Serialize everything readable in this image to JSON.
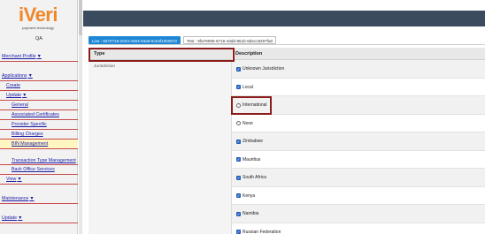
{
  "brand": {
    "name": "iVeri",
    "tagline": "payment technology",
    "environment": "QA"
  },
  "sidebar": {
    "items": [
      {
        "label": "Merchant Profile",
        "level": 0,
        "caret": true
      },
      {
        "label": "Applications",
        "level": 0,
        "caret": true
      },
      {
        "label": "Create",
        "level": 1,
        "caret": false
      },
      {
        "label": "Update",
        "level": 1,
        "caret": true
      },
      {
        "label": "General",
        "level": 2,
        "caret": false
      },
      {
        "label": "Associated Certificates",
        "level": 2,
        "caret": false
      },
      {
        "label": "Provider Specific",
        "level": 2,
        "caret": false
      },
      {
        "label": "Billing Charges",
        "level": 2,
        "caret": false
      },
      {
        "label": "BIN Management",
        "level": 2,
        "caret": false,
        "active": true
      },
      {
        "label": "Transaction Type Management",
        "level": 2,
        "caret": false
      },
      {
        "label": "Back Office Services",
        "level": 2,
        "caret": false
      },
      {
        "label": "View",
        "level": 1,
        "caret": true
      },
      {
        "label": "Maintenance",
        "level": 0,
        "caret": true
      },
      {
        "label": "Update",
        "level": 0,
        "caret": true
      },
      {
        "label": "View",
        "level": 0,
        "caret": true
      }
    ]
  },
  "tabs": [
    {
      "label": "Live : 9d72716-2044-4464-94a6-6c04f1000072",
      "active": true
    },
    {
      "label": "Test : 9fa76065-6716-43dd-851b-6decc8297fa0",
      "active": false
    }
  ],
  "table": {
    "headers": {
      "type": "Type",
      "description": "Description"
    },
    "type_value": "Jurisdiction",
    "options": [
      {
        "label": "Unknown Jurisdiction",
        "checked": true
      },
      {
        "label": "Local",
        "checked": true
      },
      {
        "label": "International",
        "checked": false
      },
      {
        "label": "None",
        "checked": false
      },
      {
        "label": "Zimbabwe",
        "checked": true
      },
      {
        "label": "Mauritius",
        "checked": true
      },
      {
        "label": "South Africa",
        "checked": true
      },
      {
        "label": "Kenya",
        "checked": true
      },
      {
        "label": "Namibia",
        "checked": true
      },
      {
        "label": "Russian Federation",
        "checked": true
      }
    ]
  },
  "colors": {
    "accent": "#1e86d6",
    "header_bar": "#3a4b5e",
    "brand_orange": "#f0872a",
    "highlight": "#8b1c1c",
    "nav_divider": "#c84a4a"
  }
}
